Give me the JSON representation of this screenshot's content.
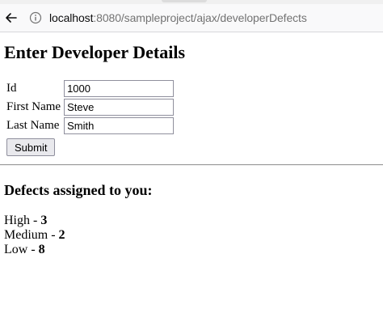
{
  "browser": {
    "url_host": "localhost",
    "url_rest": ":8080/sampleproject/ajax/developerDefects"
  },
  "page": {
    "title": "Enter Developer Details",
    "form": {
      "id_label": "Id",
      "id_value": "1000",
      "first_name_label": "First Name",
      "first_name_value": "Steve",
      "last_name_label": "Last Name",
      "last_name_value": "Smith",
      "submit_label": "Submit"
    },
    "defects": {
      "heading": "Defects assigned to you:",
      "items": [
        {
          "label": "High - ",
          "count": "3"
        },
        {
          "label": "Medium - ",
          "count": "2"
        },
        {
          "label": "Low - ",
          "count": "8"
        }
      ]
    }
  }
}
